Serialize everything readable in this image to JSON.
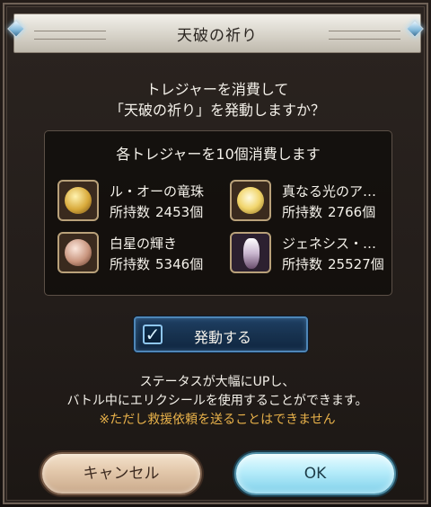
{
  "dialog": {
    "title": "天破の祈り",
    "prompt_line1": "トレジャーを消費して",
    "prompt_line2": "「天破の祈り」を発動しますか？"
  },
  "treasure_panel": {
    "heading": "各トレジャーを10個消費します",
    "count_label": "所持数",
    "items": [
      {
        "name": "ル・オーの竜珠",
        "count": "2453個",
        "icon": "dragon-orb-gold",
        "color": "#d8b34a"
      },
      {
        "name": "真なる光のア…",
        "count": "2766個",
        "icon": "light-orb-gold",
        "color": "#f1d56c"
      },
      {
        "name": "白星の輝き",
        "count": "5346個",
        "icon": "white-star-gem",
        "color": "#caa08a"
      },
      {
        "name": "ジェネシス・…",
        "count": "25527個",
        "icon": "genesis-crystal",
        "color": "#b6a3b6"
      }
    ]
  },
  "activate": {
    "label": "発動する",
    "checked": true
  },
  "description": {
    "line1": "ステータスが大幅にUPし、",
    "line2": "バトル中にエリクシールを使用することができます。",
    "warning": "※ただし救援依頼を送ることはできません"
  },
  "buttons": {
    "cancel": "キャンセル",
    "ok": "OK"
  },
  "colors": {
    "warning": "#e9b24a",
    "ok_button": "#b6ecfa",
    "cancel_button": "#e2c7aa",
    "activate_border": "#4e86b7"
  }
}
